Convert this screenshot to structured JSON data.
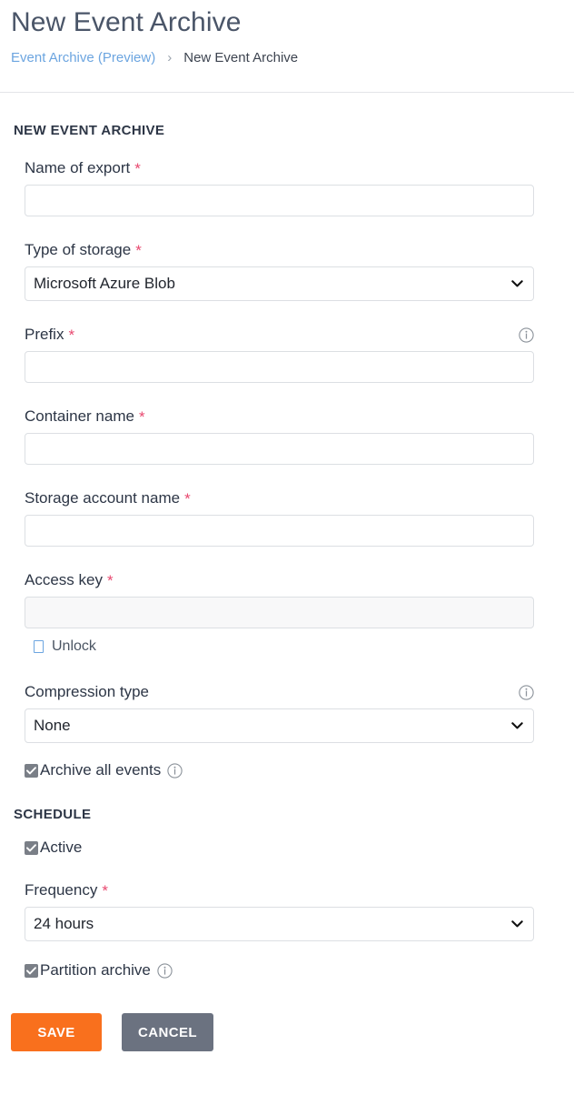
{
  "header": {
    "title": "New Event Archive",
    "breadcrumb": {
      "parent": "Event Archive (Preview)",
      "separator": "›",
      "current": "New Event Archive"
    }
  },
  "sections": {
    "archive": {
      "heading": "NEW EVENT ARCHIVE",
      "fields": {
        "name_of_export": {
          "label": "Name of export",
          "required": "*",
          "value": "",
          "placeholder": ""
        },
        "type_of_storage": {
          "label": "Type of storage",
          "required": "*",
          "value": "Microsoft Azure Blob",
          "options": [
            "Microsoft Azure Blob"
          ]
        },
        "prefix": {
          "label": "Prefix",
          "required": "*",
          "value": "",
          "placeholder": "",
          "info": "info-icon"
        },
        "container_name": {
          "label": "Container name",
          "required": "*",
          "value": "",
          "placeholder": ""
        },
        "storage_account_name": {
          "label": "Storage account name",
          "required": "*",
          "value": "",
          "placeholder": ""
        },
        "access_key": {
          "label": "Access key",
          "required": "*",
          "value": "",
          "placeholder": "",
          "disabled": true,
          "unlock_label": "Unlock"
        },
        "compression_type": {
          "label": "Compression type",
          "required": "",
          "value": "None",
          "options": [
            "None"
          ],
          "info": "info-icon"
        },
        "archive_all_events": {
          "label": "Archive all events",
          "checked": true,
          "info": "info-icon"
        }
      }
    },
    "schedule": {
      "heading": "SCHEDULE",
      "fields": {
        "active": {
          "label": "Active",
          "checked": true
        },
        "frequency": {
          "label": "Frequency",
          "required": "*",
          "value": "24 hours",
          "options": [
            "24 hours"
          ]
        },
        "partition_archive": {
          "label": "Partition archive",
          "checked": true,
          "info": "info-icon"
        }
      }
    }
  },
  "actions": {
    "save_label": "SAVE",
    "cancel_label": "CANCEL"
  },
  "colors": {
    "accent_orange": "#f9701d",
    "cancel_gray": "#6b7280",
    "link_blue": "#6ca5e0",
    "required_pink": "#e8486f",
    "checkbox_gray": "#7a7f87"
  }
}
